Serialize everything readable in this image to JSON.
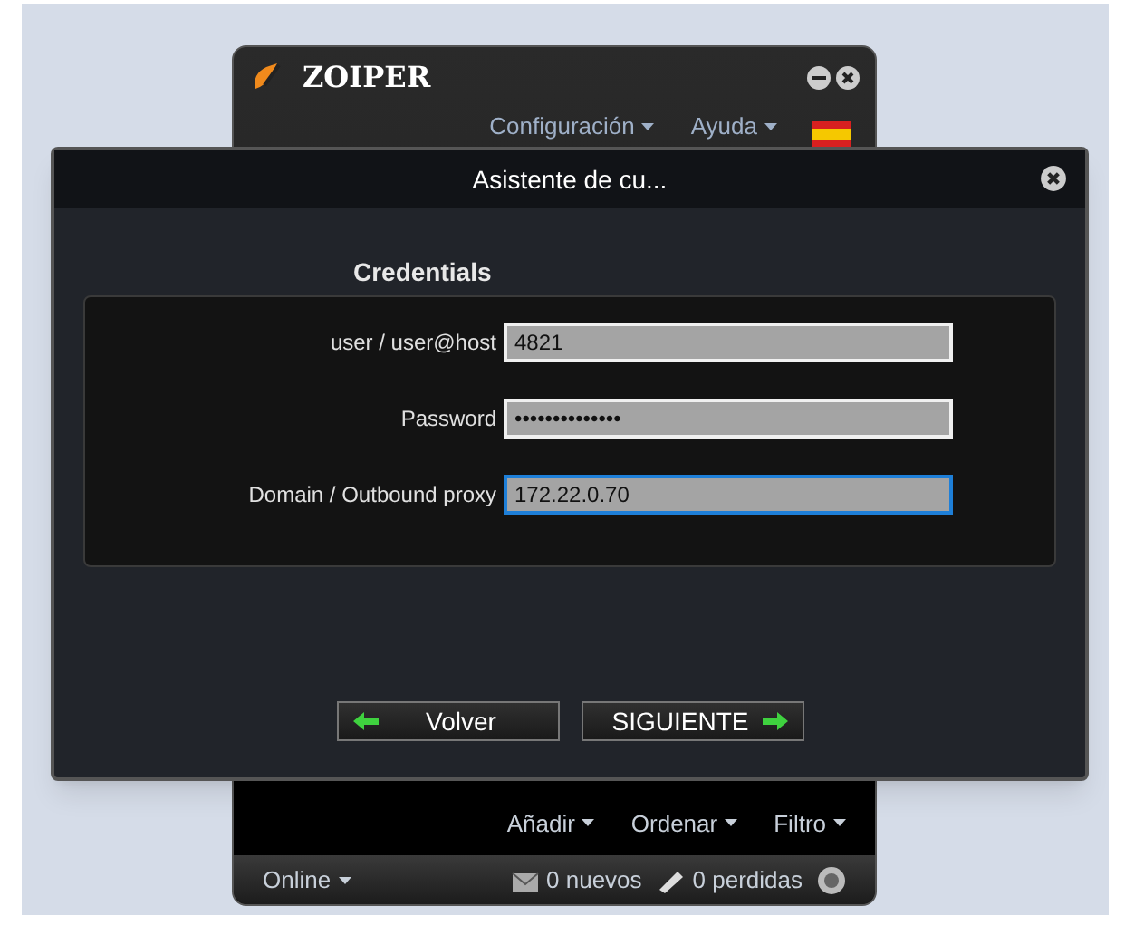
{
  "main_window": {
    "title": "ZOIPER",
    "menu": [
      {
        "label": "Configuración"
      },
      {
        "label": "Ayuda"
      }
    ],
    "list_toolbar": [
      {
        "label": "Añadir"
      },
      {
        "label": "Ordenar"
      },
      {
        "label": "Filtro"
      }
    ],
    "status_bar": {
      "presence": "Online",
      "new_messages": "0 nuevos",
      "missed_calls": "0 perdidas"
    }
  },
  "dialog": {
    "title": "Asistente de cu...",
    "section": "Credentials",
    "fields": [
      {
        "label": "user / user@host",
        "value": "4821",
        "focused": false
      },
      {
        "label": "Password",
        "value": "••••••••••••••",
        "focused": false
      },
      {
        "label": "Domain / Outbound proxy",
        "value": "172.22.0.70",
        "focused": true
      }
    ],
    "buttons": [
      {
        "label": "Volver",
        "kind": "back"
      },
      {
        "label": "SIGUIENTE",
        "kind": "next"
      }
    ]
  }
}
